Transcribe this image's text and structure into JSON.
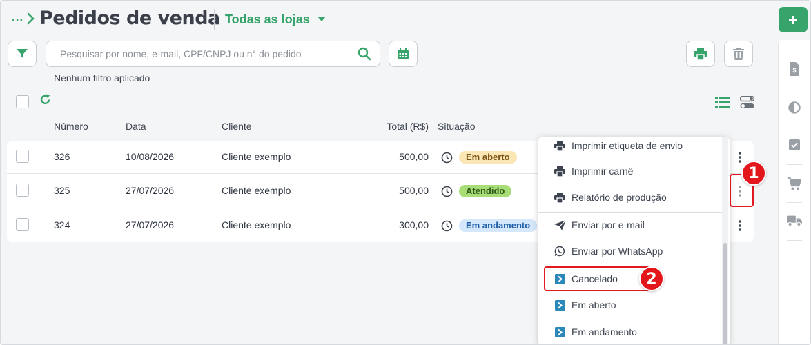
{
  "header": {
    "breadcrumb": "...",
    "title": "Pedidos de venda",
    "store_selector": "Todas as lojas"
  },
  "toolbar": {
    "search_placeholder": "Pesquisar por nome, e-mail, CPF/CNPJ ou n° do pedido",
    "filters_note": "Nenhum filtro aplicado"
  },
  "table": {
    "columns": [
      "Número",
      "Data",
      "Cliente",
      "Total (R$)",
      "Situação"
    ],
    "rows": [
      {
        "numero": "326",
        "data": "10/08/2026",
        "cliente": "Cliente exemplo",
        "total": "500,00",
        "situacao": "Em aberto"
      },
      {
        "numero": "325",
        "data": "27/07/2026",
        "cliente": "Cliente exemplo",
        "total": "500,00",
        "situacao": "Atendido"
      },
      {
        "numero": "324",
        "data": "27/07/2026",
        "cliente": "Cliente exemplo",
        "total": "300,00",
        "situacao": "Em andamento"
      }
    ]
  },
  "menu": {
    "items": [
      {
        "label": "Imprimir etiqueta de envio",
        "icon": "printer-icon"
      },
      {
        "label": "Imprimir carnê",
        "icon": "printer-icon"
      },
      {
        "label": "Relatório de produção",
        "icon": "printer-icon"
      },
      {
        "label": "Enviar por e-mail",
        "icon": "send-icon"
      },
      {
        "label": "Enviar por WhatsApp",
        "icon": "whatsapp-icon"
      },
      {
        "label": "Cancelado",
        "icon": "status-arrow-icon"
      },
      {
        "label": "Em aberto",
        "icon": "status-arrow-icon"
      },
      {
        "label": "Em andamento",
        "icon": "status-arrow-icon"
      }
    ]
  },
  "callouts": [
    "1",
    "2"
  ],
  "colors": {
    "brand_green": "#37a46b",
    "badge_open_bg": "#fbe7b5",
    "badge_done_bg": "#a8dc76",
    "badge_progress_bg": "#d4e7fb",
    "callout_red": "#e3161c"
  }
}
